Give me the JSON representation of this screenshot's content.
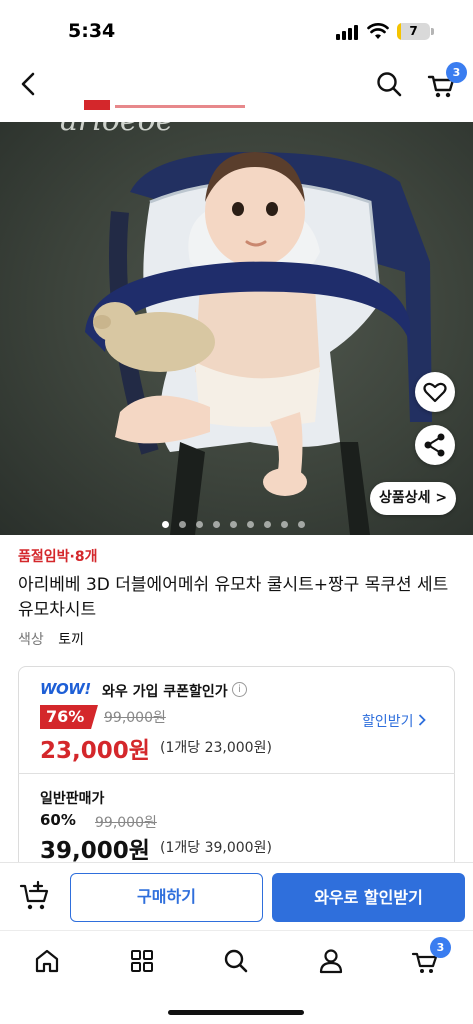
{
  "status_bar": {
    "time": "5:34",
    "battery_level": "7",
    "battery_fraction": 0.07
  },
  "nav": {
    "cart_count": "3"
  },
  "hero": {
    "image_brand_text": "arioeoe",
    "detail_button_label": "상품상세 >",
    "page_dots_total": 9,
    "page_dots_active": 0
  },
  "product": {
    "urgency_label": "품절임박·8개",
    "title": "아리베베 3D 더블에어메쉬 유모차 쿨시트+짱구 목쿠션 세트 유모차시트",
    "option_label": "색상",
    "option_value": "토끼"
  },
  "price_card": {
    "wow": {
      "logo": "WOW!",
      "title": "와우 가입 쿠폰할인가",
      "info_glyph": "i",
      "discount": "76%",
      "original_price": "99,000원",
      "sale_price": "23,000원",
      "unit_price": "(1개당 23,000원)",
      "coupon_link": "할인받기"
    },
    "normal": {
      "title": "일반판매가",
      "discount": "60%",
      "original_price": "99,000원",
      "sale_price": "39,000원",
      "unit_price": "(1개당 39,000원)"
    }
  },
  "action_bar": {
    "buy_label": "구매하기",
    "wow_buy_label": "와우로 할인받기"
  },
  "tab_bar": {
    "cart_count": "3"
  },
  "colors": {
    "brand_blue": "#2f6fdc",
    "sale_red": "#d4272b",
    "badge_blue": "#3a7df0"
  }
}
